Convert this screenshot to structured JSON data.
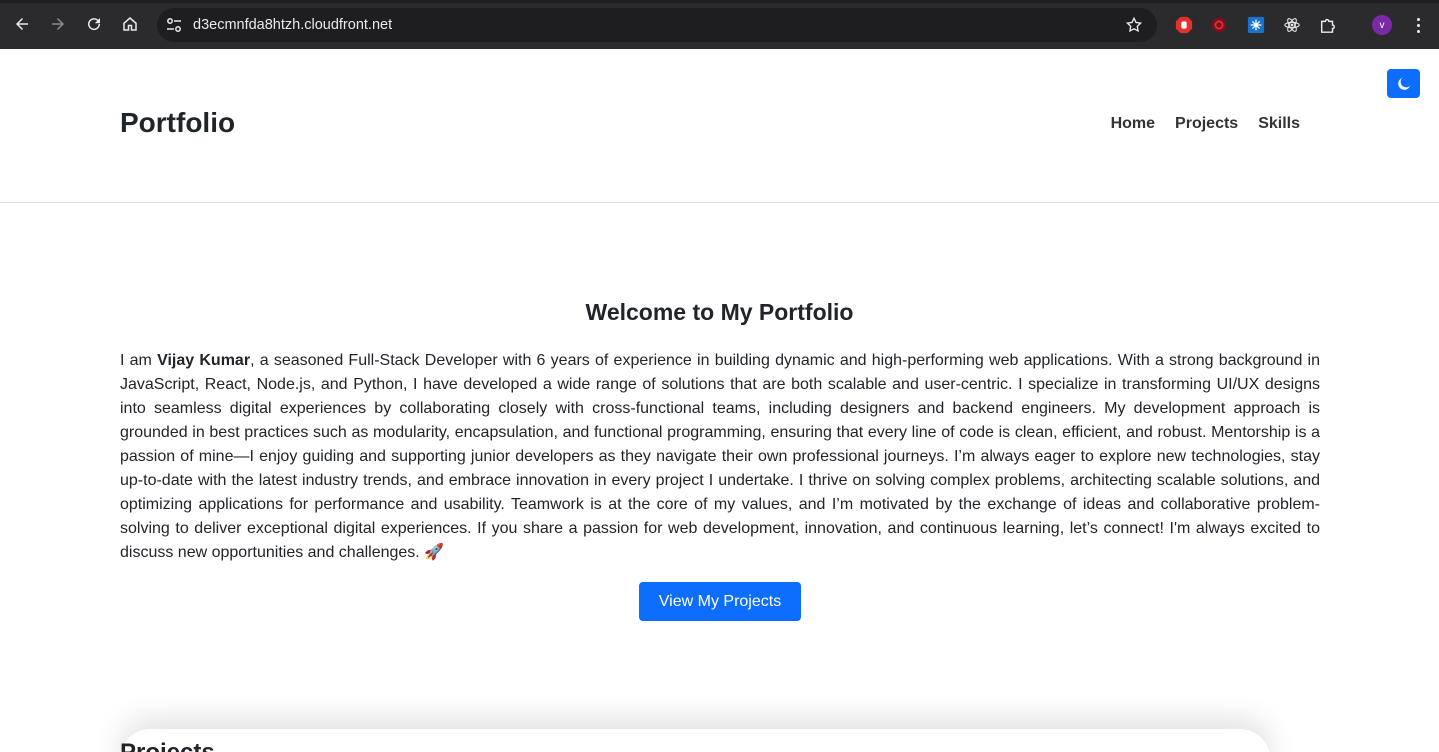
{
  "browser": {
    "url": "d3ecmnfda8htzh.cloudfront.net",
    "profile_initial": "v",
    "icons": [
      "back-icon",
      "forward-icon",
      "reload-icon",
      "home-icon",
      "site-settings-icon",
      "star-icon",
      "extension-adblock-icon",
      "extension-red-icon",
      "extension-blue-icon",
      "react-devtools-icon",
      "extensions-puzzle-icon",
      "menu-icon"
    ]
  },
  "header": {
    "brand": "Portfolio",
    "nav": [
      {
        "label": "Home"
      },
      {
        "label": "Projects"
      },
      {
        "label": "Skills"
      }
    ],
    "theme_toggle_icon": "moon-icon"
  },
  "hero": {
    "title": "Welcome to My Portfolio",
    "intro_prefix": "I am ",
    "name": "Vijay Kumar",
    "intro_rest": ", a seasoned Full-Stack Developer with 6 years of experience in building dynamic and high-performing web applications. With a strong background in JavaScript, React, Node.js, and Python, I have developed a wide range of solutions that are both scalable and user-centric. I specialize in transforming UI/UX designs into seamless digital experiences by collaborating closely with cross-functional teams, including designers and backend engineers. My development approach is grounded in best practices such as modularity, encapsulation, and functional programming, ensuring that every line of code is clean, efficient, and robust. Mentorship is a passion of mine—I enjoy guiding and supporting junior developers as they navigate their own professional journeys. I’m always eager to explore new technologies, stay up-to-date with the latest industry trends, and embrace innovation in every project I undertake. I thrive on solving complex problems, architecting scalable solutions, and optimizing applications for performance and usability. Teamwork is at the core of my values, and I’m motivated by the exchange of ideas and collaborative problem-solving to deliver exceptional digital experiences. If you share a passion for web development, innovation, and continuous learning, let’s connect! I'm always excited to discuss new opportunities and challenges. 🚀",
    "cta_label": "View My Projects"
  },
  "projects": {
    "title": "Projects"
  },
  "colors": {
    "primary": "#0d6efd",
    "chrome_bg": "#2b2b2d",
    "text": "#212529"
  }
}
